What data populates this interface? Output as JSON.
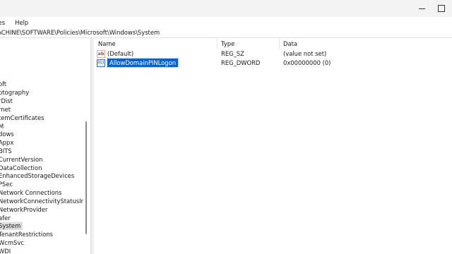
{
  "menu": {
    "items": [
      "ites",
      "Help"
    ]
  },
  "address": {
    "path": "MACHINE\\SOFTWARE\\Policies\\Microsoft\\Windows\\System"
  },
  "tree": {
    "items": [
      {
        "label": "oft"
      },
      {
        "label": "ptography"
      },
      {
        "label": "rDist"
      },
      {
        "label": "rnet"
      },
      {
        "label": "temCertificates"
      },
      {
        "label": "M"
      },
      {
        "label": "dows"
      },
      {
        "label": "Appx"
      },
      {
        "label": "BITS"
      },
      {
        "label": "CurrentVersion"
      },
      {
        "label": "DataCollection"
      },
      {
        "label": "EnhancedStorageDevices"
      },
      {
        "label": "PSec"
      },
      {
        "label": "Network Connections"
      },
      {
        "label": "NetworkConnectivityStatusInd"
      },
      {
        "label": "NetworkProvider"
      },
      {
        "label": "afer"
      },
      {
        "label": "System",
        "selected": true
      },
      {
        "label": "TenantRestrictions"
      },
      {
        "label": "WcmSvc"
      },
      {
        "label": "WDI"
      }
    ]
  },
  "values": {
    "columns": {
      "name": "Name",
      "type": "Type",
      "data": "Data"
    },
    "rows": [
      {
        "icon": "string-value-icon",
        "name": "(Default)",
        "type": "REG_SZ",
        "data": "(value not set)",
        "selected": false
      },
      {
        "icon": "binary-value-icon",
        "name": "AllowDomainPINLogon",
        "type": "REG_DWORD",
        "data": "0x00000000 (0)",
        "selected": true
      }
    ]
  }
}
